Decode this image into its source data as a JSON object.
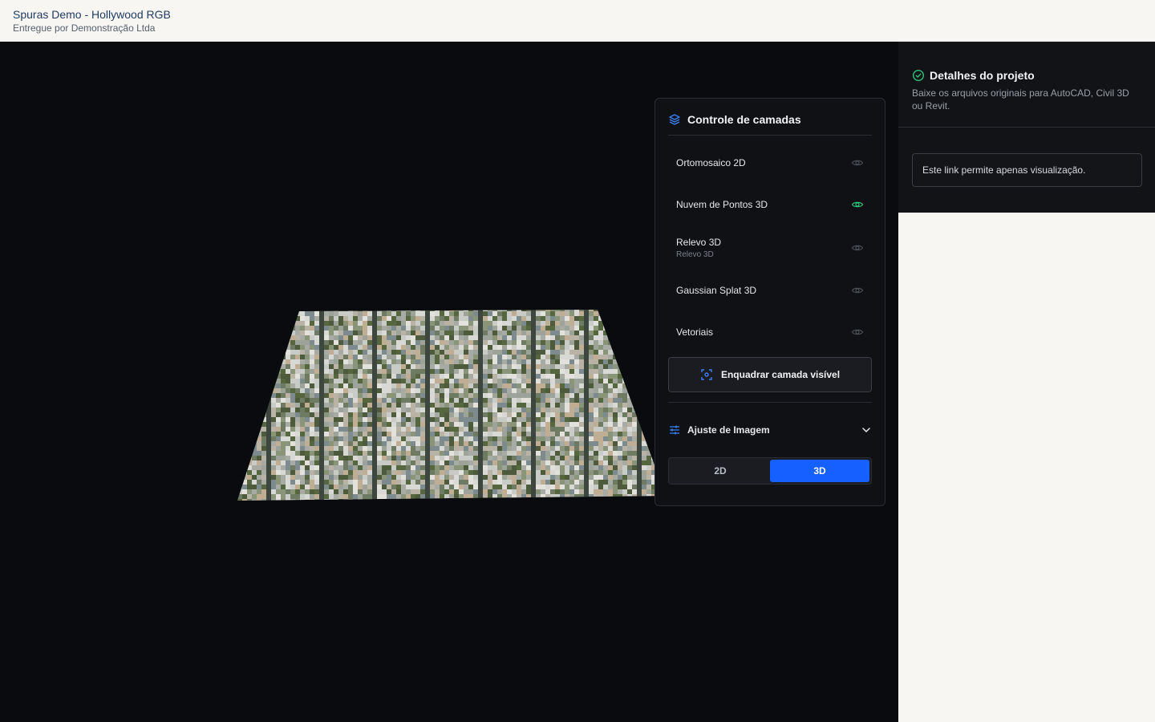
{
  "header": {
    "title": "Spuras Demo - Hollywood RGB",
    "subtitle": "Entregue por Demonstração Ltda"
  },
  "layers_panel": {
    "title": "Controle de camadas",
    "icon": "layers-icon",
    "layers": [
      {
        "name": "Ortomosaico 2D",
        "subtitle": "",
        "visible": false
      },
      {
        "name": "Nuvem de Pontos 3D",
        "subtitle": "",
        "visible": true
      },
      {
        "name": "Relevo 3D",
        "subtitle": "Relevo 3D",
        "visible": false
      },
      {
        "name": "Gaussian Splat 3D",
        "subtitle": "",
        "visible": false
      },
      {
        "name": "Vetoriais",
        "subtitle": "",
        "visible": false
      }
    ],
    "fit_button": "Enquadrar camada visível",
    "image_adjust_label": "Ajuste de Imagem",
    "view_modes": [
      "2D",
      "3D"
    ],
    "active_view_mode": "3D"
  },
  "project_details": {
    "title": "Detalhes do projeto",
    "description": "Baixe os arquivos originais para AutoCAD, Civil 3D ou Revit.",
    "notice": "Este link permite apenas visualização."
  },
  "colors": {
    "accent_blue": "#1660ff",
    "visible_green": "#2ec47a",
    "hidden_gray": "#4a4e55",
    "title_blue": "#1e3a5f"
  }
}
